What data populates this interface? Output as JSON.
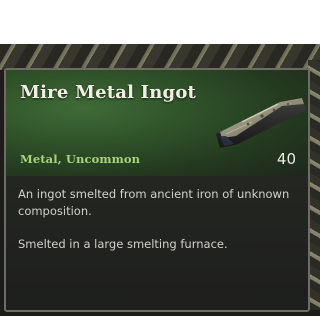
{
  "tooltip": {
    "title": "Mire Metal Ingot",
    "category": "Metal, Uncommon",
    "count": "40",
    "icon": "mire-metal-ingot-icon",
    "description": "An ingot smelted from ancient iron of unknown composition.",
    "source": "Smelted in a large smelting furnace."
  },
  "colors": {
    "header_green": "#3f6b37",
    "rarity_text": "#a9d27a",
    "panel_border": "#6f6d63",
    "panel_bg": "#1f201e"
  }
}
